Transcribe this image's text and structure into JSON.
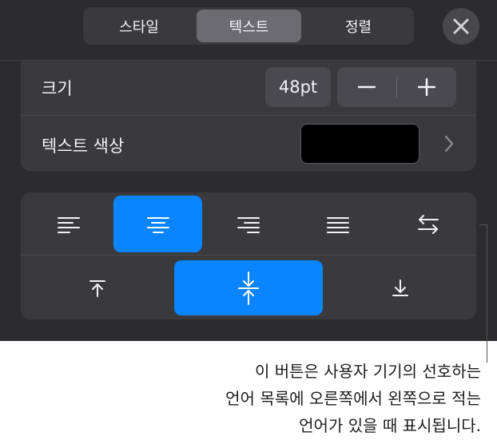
{
  "tabs": [
    {
      "label": "스타일",
      "selected": false
    },
    {
      "label": "텍스트",
      "selected": true
    },
    {
      "label": "정렬",
      "selected": false
    }
  ],
  "close_icon": "close-icon",
  "size": {
    "label": "크기",
    "value": "48pt",
    "minus_icon": "minus-icon",
    "plus_icon": "plus-icon"
  },
  "text_color": {
    "label": "텍스트 색상",
    "swatch_color": "#000000",
    "chevron_icon": "chevron-right-icon"
  },
  "horizontal_alignment": [
    {
      "icon": "align-left-icon",
      "selected": false
    },
    {
      "icon": "align-center-icon",
      "selected": true
    },
    {
      "icon": "align-right-icon",
      "selected": false
    },
    {
      "icon": "align-justify-icon",
      "selected": false
    },
    {
      "icon": "text-direction-icon",
      "selected": false
    }
  ],
  "vertical_alignment": [
    {
      "icon": "align-top-icon",
      "selected": false
    },
    {
      "icon": "align-middle-icon",
      "selected": true
    },
    {
      "icon": "align-bottom-icon",
      "selected": false
    }
  ],
  "accent_color": "#0a84ff",
  "caption": {
    "line1": "이 버튼은 사용자 기기의 선호하는",
    "line2": "언어 목록에 오른쪽에서 왼쪽으로 적는",
    "line3": "언어가 있을 때 표시됩니다."
  }
}
